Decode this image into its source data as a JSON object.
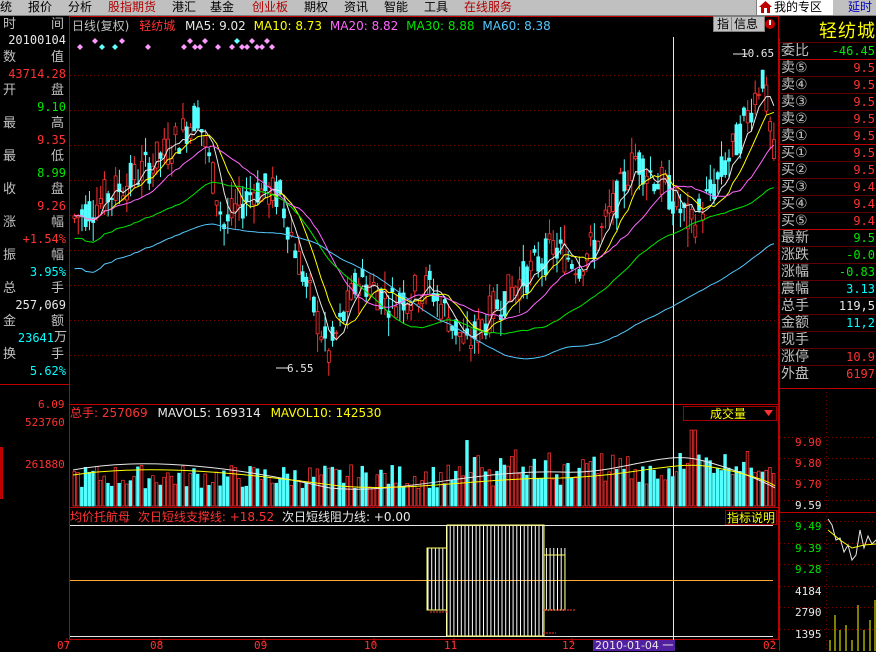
{
  "menu": {
    "items": [
      {
        "label": "统",
        "color": "#000000"
      },
      {
        "label": "报价",
        "color": "#000000"
      },
      {
        "label": "分析",
        "color": "#000000"
      },
      {
        "label": "股指期货",
        "color": "#b00000"
      },
      {
        "label": "港汇",
        "color": "#000000"
      },
      {
        "label": "基金",
        "color": "#000000"
      },
      {
        "label": "创业板",
        "color": "#b00000"
      },
      {
        "label": "期权",
        "color": "#000000"
      },
      {
        "label": "资讯",
        "color": "#000000"
      },
      {
        "label": "智能",
        "color": "#000000"
      },
      {
        "label": "工具",
        "color": "#000000"
      },
      {
        "label": "在线服务",
        "color": "#b00000"
      }
    ],
    "favorites": "我的专区",
    "delay": "延时"
  },
  "chart_header": {
    "period": "日线(复权)",
    "stock": "轻纺城",
    "ma5": "MA5: 9.02",
    "ma10": "MA10: 8.73",
    "ma20": "MA20: 8.82",
    "ma30": "MA30: 8.88",
    "ma60": "MA60: 8.38"
  },
  "info_panel": {
    "time_label": [
      "时",
      "间"
    ],
    "date": "20100104",
    "count_label": [
      "数",
      "值"
    ],
    "count_value": "43714.28",
    "open_label": [
      "开",
      "盘"
    ],
    "open": "9.10",
    "high_label": [
      "最",
      "高"
    ],
    "high": "9.35",
    "low_label": [
      "最",
      "低"
    ],
    "low": "8.99",
    "close_label": [
      "收",
      "盘"
    ],
    "close": "9.26",
    "chg_label": [
      "涨",
      "幅"
    ],
    "chg": "+1.54%",
    "amp_label": [
      "振",
      "幅"
    ],
    "amp": "3.95%",
    "vol_label": [
      "总",
      "手"
    ],
    "vol": "257,069",
    "amt_label": [
      "金",
      "额"
    ],
    "amt": "23641",
    "amt_unit": "万",
    "turn_label": [
      "换",
      "手"
    ],
    "turn": "5.62%"
  },
  "price_axis": {
    "bottom": "6.09",
    "high_mark": "10.65",
    "low_mark": "6.55"
  },
  "volume": {
    "total": "总手: 257069",
    "mavol5": "MAVOL5: 169314",
    "mavol10": "MAVOL10: 142530",
    "indicator": "成交量",
    "axis_top": "523760",
    "axis_mid": "261880"
  },
  "indicator": {
    "title": "均价托航母",
    "support": "次日短线支撑线: +18.52",
    "resist": "次日短线阻力线: +0.00",
    "explain": "指标说明"
  },
  "x_axis": {
    "labels": [
      "07",
      "08",
      "09",
      "10",
      "11",
      "12",
      "02"
    ],
    "selected": "2010-01-04 一"
  },
  "quote": {
    "name": "轻纺城",
    "rows": [
      {
        "k": "委比",
        "v": "-46.45",
        "c": "#00e600"
      },
      {
        "k": "卖⑤",
        "v": "9.5",
        "c": "#ff3232"
      },
      {
        "k": "卖④",
        "v": "9.5",
        "c": "#ff3232"
      },
      {
        "k": "卖③",
        "v": "9.5",
        "c": "#ff3232"
      },
      {
        "k": "卖②",
        "v": "9.5",
        "c": "#ff3232"
      },
      {
        "k": "卖①",
        "v": "9.5",
        "c": "#ff3232"
      },
      {
        "k": "买①",
        "v": "9.5",
        "c": "#ff3232"
      },
      {
        "k": "买②",
        "v": "9.5",
        "c": "#ff3232"
      },
      {
        "k": "买③",
        "v": "9.4",
        "c": "#ff3232"
      },
      {
        "k": "买④",
        "v": "9.4",
        "c": "#ff3232"
      },
      {
        "k": "买⑤",
        "v": "9.4",
        "c": "#ff3232"
      },
      {
        "k": "最新",
        "v": "9.5",
        "c": "#00e600"
      },
      {
        "k": "涨跌",
        "v": "-0.0",
        "c": "#00e600"
      },
      {
        "k": "涨幅",
        "v": "-0.83",
        "c": "#00e600"
      },
      {
        "k": "震幅",
        "v": "3.13",
        "c": "#00ffff"
      },
      {
        "k": "总手",
        "v": "119,5",
        "c": "#e8e8e8"
      },
      {
        "k": "金额",
        "v": "11,2",
        "c": "#00ffff"
      },
      {
        "k": "现手",
        "v": "",
        "c": "#e8e8e8"
      },
      {
        "k": "涨停",
        "v": "10.9",
        "c": "#ff3232"
      },
      {
        "k": "外盘",
        "v": "6197",
        "c": "#ff3232"
      }
    ],
    "mini_axis": [
      "9.90",
      "9.80",
      "9.70",
      "9.59",
      "9.49",
      "9.39",
      "9.28",
      "4184",
      "2790",
      "1395"
    ]
  }
}
